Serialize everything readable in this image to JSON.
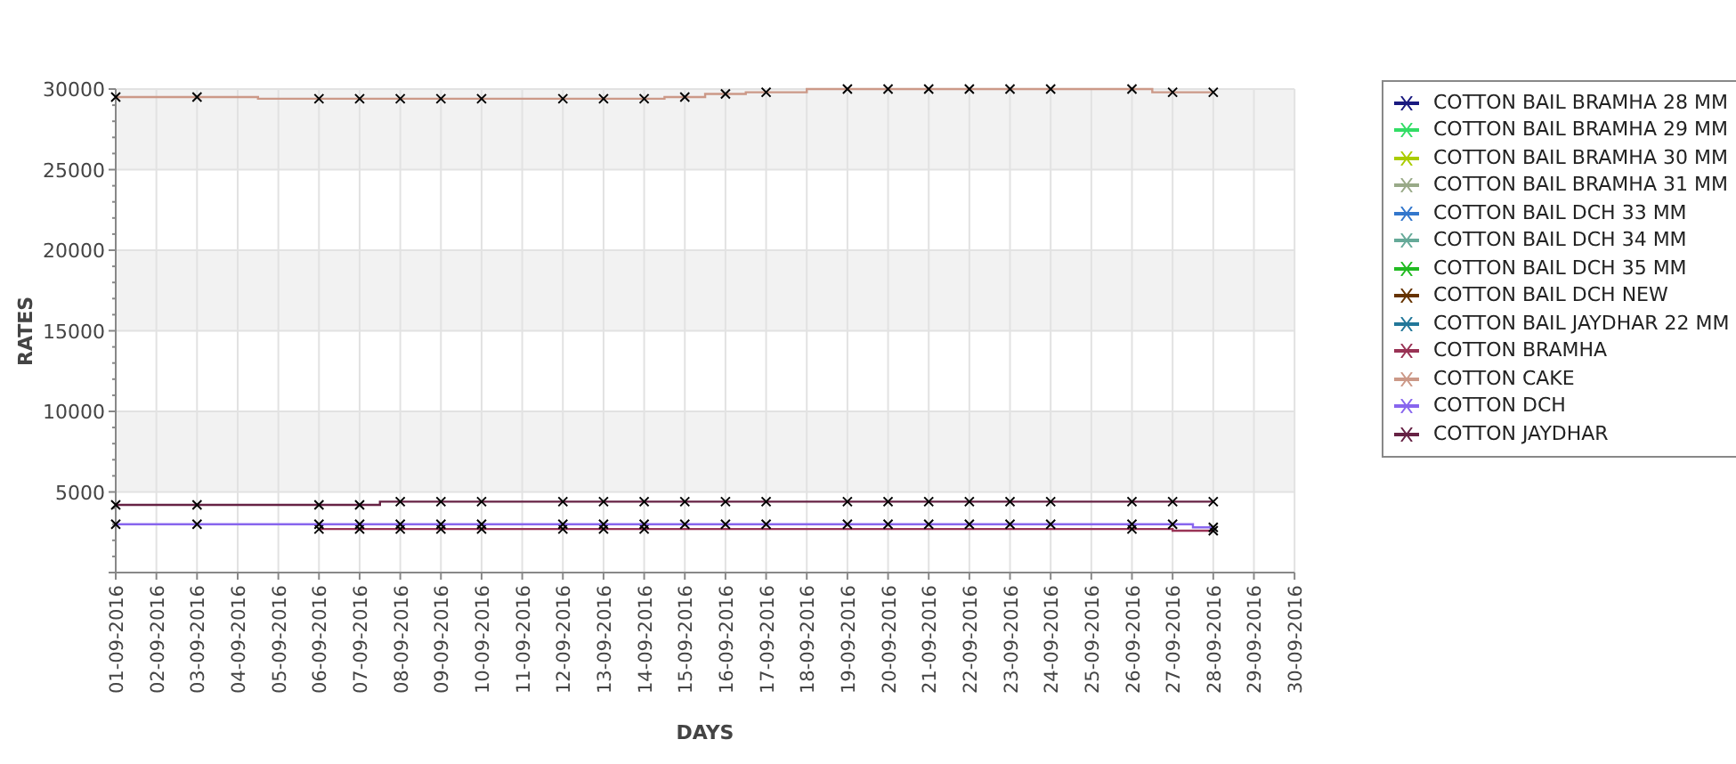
{
  "chart": {
    "chart_data": {
      "type": "line",
      "xlabel": "DAYS",
      "ylabel": "RATES",
      "grid": true,
      "categories": [
        "01-09-2016",
        "02-09-2016",
        "03-09-2016",
        "04-09-2016",
        "05-09-2016",
        "06-09-2016",
        "07-09-2016",
        "08-09-2016",
        "09-09-2016",
        "10-09-2016",
        "11-09-2016",
        "12-09-2016",
        "13-09-2016",
        "14-09-2016",
        "15-09-2016",
        "16-09-2016",
        "17-09-2016",
        "18-09-2016",
        "19-09-2016",
        "20-09-2016",
        "21-09-2016",
        "22-09-2016",
        "23-09-2016",
        "24-09-2016",
        "25-09-2016",
        "26-09-2016",
        "27-09-2016",
        "28-09-2016",
        "29-09-2016",
        "30-09-2016"
      ],
      "ylim": [
        0,
        30000
      ],
      "yticks": [
        5000,
        10000,
        15000,
        20000,
        25000,
        30000
      ],
      "series": [
        {
          "name": "COTTON BAIL BRAMHA 28 MM",
          "color": "#1a1a80",
          "values": [
            null,
            null,
            null,
            null,
            null,
            null,
            null,
            null,
            null,
            null,
            null,
            null,
            null,
            null,
            null,
            null,
            null,
            null,
            null,
            null,
            null,
            null,
            null,
            null,
            null,
            null,
            null,
            null,
            null,
            null
          ]
        },
        {
          "name": "COTTON BAIL BRAMHA 29 MM",
          "color": "#33dd66",
          "values": [
            null,
            null,
            null,
            null,
            null,
            null,
            null,
            null,
            null,
            null,
            null,
            null,
            null,
            null,
            null,
            null,
            null,
            null,
            null,
            null,
            null,
            null,
            null,
            null,
            null,
            null,
            null,
            null,
            null,
            null
          ]
        },
        {
          "name": "COTTON BAIL BRAMHA 30 MM",
          "color": "#aacc00",
          "values": [
            null,
            null,
            null,
            null,
            null,
            null,
            null,
            null,
            null,
            null,
            null,
            null,
            null,
            null,
            null,
            null,
            null,
            null,
            null,
            null,
            null,
            null,
            null,
            null,
            null,
            null,
            null,
            null,
            null,
            null
          ]
        },
        {
          "name": "COTTON BAIL BRAMHA 31 MM",
          "color": "#99aa88",
          "values": [
            null,
            null,
            null,
            null,
            null,
            null,
            null,
            null,
            null,
            null,
            null,
            null,
            null,
            null,
            null,
            null,
            null,
            null,
            null,
            null,
            null,
            null,
            null,
            null,
            null,
            null,
            null,
            null,
            null,
            null
          ]
        },
        {
          "name": "COTTON BAIL DCH 33 MM",
          "color": "#3377cc",
          "values": [
            null,
            null,
            null,
            null,
            null,
            null,
            null,
            null,
            null,
            null,
            null,
            null,
            null,
            null,
            null,
            null,
            null,
            null,
            null,
            null,
            null,
            null,
            null,
            null,
            null,
            null,
            null,
            null,
            null,
            null
          ]
        },
        {
          "name": "COTTON BAIL DCH 34 MM",
          "color": "#66aa99",
          "values": [
            null,
            null,
            null,
            null,
            null,
            null,
            null,
            null,
            null,
            null,
            null,
            null,
            null,
            null,
            null,
            null,
            null,
            null,
            null,
            null,
            null,
            null,
            null,
            null,
            null,
            null,
            null,
            null,
            null,
            null
          ]
        },
        {
          "name": "COTTON BAIL DCH 35 MM",
          "color": "#22bb22",
          "values": [
            null,
            null,
            null,
            null,
            null,
            null,
            null,
            null,
            null,
            null,
            null,
            null,
            null,
            null,
            null,
            null,
            null,
            null,
            null,
            null,
            null,
            null,
            null,
            null,
            null,
            null,
            null,
            null,
            null,
            null
          ]
        },
        {
          "name": "COTTON BAIL DCH NEW",
          "color": "#663300",
          "values": [
            null,
            null,
            null,
            null,
            null,
            null,
            null,
            null,
            null,
            null,
            null,
            null,
            null,
            null,
            null,
            null,
            null,
            null,
            null,
            null,
            null,
            null,
            null,
            null,
            null,
            null,
            null,
            null,
            null,
            null
          ]
        },
        {
          "name": "COTTON BAIL JAYDHAR 22 MM",
          "color": "#227799",
          "values": [
            null,
            null,
            null,
            null,
            null,
            null,
            null,
            null,
            null,
            null,
            null,
            null,
            null,
            null,
            null,
            null,
            null,
            null,
            null,
            null,
            null,
            null,
            null,
            null,
            null,
            null,
            null,
            null,
            null,
            null
          ]
        },
        {
          "name": "COTTON BRAMHA",
          "color": "#993355",
          "marker": "x",
          "values": [
            null,
            null,
            null,
            null,
            null,
            2700,
            2700,
            2700,
            2700,
            2700,
            null,
            2700,
            2700,
            2700,
            null,
            null,
            null,
            null,
            null,
            null,
            null,
            null,
            null,
            null,
            null,
            2700,
            null,
            2600,
            null,
            null
          ]
        },
        {
          "name": "COTTON CAKE",
          "color": "#cc9988",
          "marker": "x",
          "values": [
            29500,
            null,
            29500,
            null,
            null,
            29400,
            29400,
            29400,
            29400,
            29400,
            null,
            29400,
            29400,
            29400,
            29500,
            29700,
            29800,
            null,
            30000,
            30000,
            30000,
            30000,
            30000,
            30000,
            null,
            30000,
            29800,
            29800,
            null,
            null
          ]
        },
        {
          "name": "COTTON DCH",
          "color": "#8866ee",
          "marker": "x",
          "values": [
            3000,
            null,
            3000,
            null,
            null,
            3000,
            3000,
            3000,
            3000,
            3000,
            null,
            3000,
            3000,
            3000,
            3000,
            3000,
            3000,
            null,
            3000,
            3000,
            3000,
            3000,
            3000,
            3000,
            null,
            3000,
            3000,
            2800,
            null,
            null
          ]
        },
        {
          "name": "COTTON JAYDHAR",
          "color": "#662244",
          "marker": "x",
          "values": [
            4200,
            null,
            4200,
            null,
            null,
            4200,
            4200,
            4400,
            4400,
            4400,
            null,
            4400,
            4400,
            4400,
            4400,
            4400,
            4400,
            null,
            4400,
            4400,
            4400,
            4400,
            4400,
            4400,
            null,
            4400,
            4400,
            4400,
            null,
            null
          ]
        }
      ]
    }
  }
}
